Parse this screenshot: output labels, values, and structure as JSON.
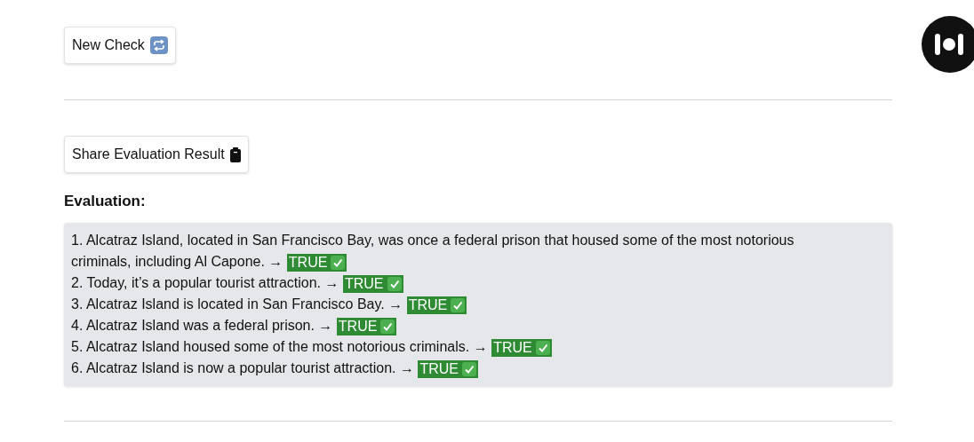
{
  "new_check_button": {
    "label": "New Check"
  },
  "share_button": {
    "label": "Share Evaluation Result"
  },
  "evaluation": {
    "heading": "Evaluation:",
    "items": [
      {
        "lines": [
          "1. Alcatraz Island, located in San Francisco Bay, was once a federal prison that housed some of the most notorious",
          "criminals, including Al Capone. →"
        ],
        "verdict": "TRUE",
        "true": true
      },
      {
        "lines": [
          "2. Today, it’s a popular tourist attraction. →"
        ],
        "verdict": "TRUE",
        "true": true
      },
      {
        "lines": [
          "3. Alcatraz Island is located in San Francisco Bay. →"
        ],
        "verdict": "TRUE",
        "true": true
      },
      {
        "lines": [
          "4. Alcatraz Island was a federal prison. →"
        ],
        "verdict": "TRUE",
        "true": true
      },
      {
        "lines": [
          "5. Alcatraz Island housed some of the most notorious criminals. →"
        ],
        "verdict": "TRUE",
        "true": true
      },
      {
        "lines": [
          "6. Alcatraz Island is now a popular tourist attraction. →"
        ],
        "verdict": "TRUE",
        "true": true
      }
    ]
  }
}
